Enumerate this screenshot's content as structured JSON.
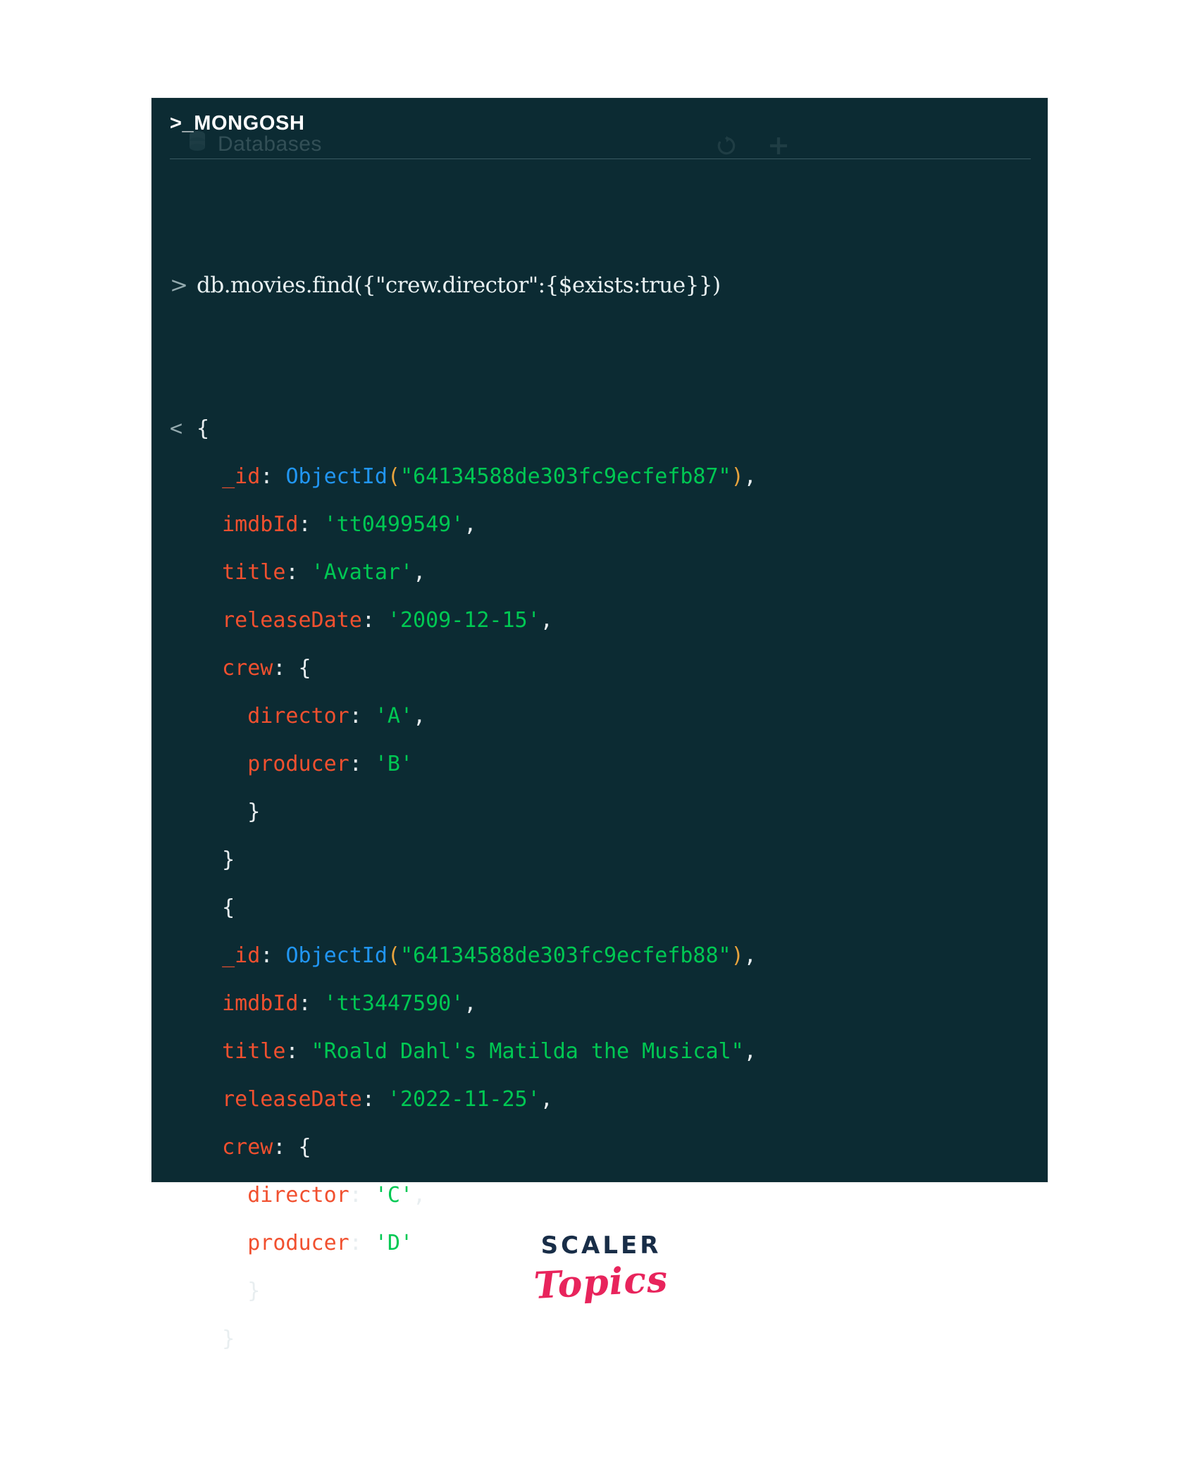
{
  "window": {
    "title": "MONGOSH",
    "prompt_glyph": ">_",
    "ghost": {
      "databases_label": "Databases",
      "database_icon": "database-icon",
      "refresh_icon": "refresh-icon",
      "add_icon": "plus-icon"
    },
    "background_color": "#0c2b33",
    "divider_color": "#3a5b63"
  },
  "command": {
    "gutter_glyph": ">",
    "text": "db.movies.find({\"crew.director\":{$exists:true}})"
  },
  "output": {
    "gutter_glyph": "<",
    "lines": [
      {
        "gutter": "<",
        "indent": 0,
        "tokens": [
          {
            "t": "{",
            "c": "brace"
          }
        ]
      },
      {
        "gutter": "",
        "indent": 1,
        "tokens": [
          {
            "t": "_id",
            "c": "key"
          },
          {
            "t": ": ",
            "c": "punct"
          },
          {
            "t": "ObjectId",
            "c": "func"
          },
          {
            "t": "(",
            "c": "paren"
          },
          {
            "t": "\"64134588de303fc9ecfefb87\"",
            "c": "string"
          },
          {
            "t": ")",
            "c": "paren"
          },
          {
            "t": ",",
            "c": "comma"
          }
        ]
      },
      {
        "gutter": "",
        "indent": 1,
        "tokens": [
          {
            "t": "imdbId",
            "c": "key"
          },
          {
            "t": ": ",
            "c": "punct"
          },
          {
            "t": "'tt0499549'",
            "c": "string"
          },
          {
            "t": ",",
            "c": "comma"
          }
        ]
      },
      {
        "gutter": "",
        "indent": 1,
        "tokens": [
          {
            "t": "title",
            "c": "key"
          },
          {
            "t": ": ",
            "c": "punct"
          },
          {
            "t": "'Avatar'",
            "c": "string"
          },
          {
            "t": ",",
            "c": "comma"
          }
        ]
      },
      {
        "gutter": "",
        "indent": 1,
        "tokens": [
          {
            "t": "releaseDate",
            "c": "key"
          },
          {
            "t": ": ",
            "c": "punct"
          },
          {
            "t": "'2009-12-15'",
            "c": "string"
          },
          {
            "t": ",",
            "c": "comma"
          }
        ]
      },
      {
        "gutter": "",
        "indent": 1,
        "tokens": [
          {
            "t": "crew",
            "c": "key"
          },
          {
            "t": ": ",
            "c": "punct"
          },
          {
            "t": "{",
            "c": "brace"
          }
        ]
      },
      {
        "gutter": "",
        "indent": 2,
        "tokens": [
          {
            "t": "director",
            "c": "key"
          },
          {
            "t": ": ",
            "c": "punct"
          },
          {
            "t": "'A'",
            "c": "string"
          },
          {
            "t": ",",
            "c": "comma"
          }
        ]
      },
      {
        "gutter": "",
        "indent": 2,
        "tokens": [
          {
            "t": "producer",
            "c": "key"
          },
          {
            "t": ": ",
            "c": "punct"
          },
          {
            "t": "'B'",
            "c": "string"
          }
        ]
      },
      {
        "gutter": "",
        "indent": 2,
        "tokens": [
          {
            "t": "}",
            "c": "brace"
          }
        ]
      },
      {
        "gutter": "",
        "indent": 1,
        "tokens": [
          {
            "t": "}",
            "c": "brace"
          }
        ]
      },
      {
        "gutter": "",
        "indent": 1,
        "tokens": [
          {
            "t": "{",
            "c": "brace"
          }
        ]
      },
      {
        "gutter": "",
        "indent": 1,
        "tokens": [
          {
            "t": "_id",
            "c": "key"
          },
          {
            "t": ": ",
            "c": "punct"
          },
          {
            "t": "ObjectId",
            "c": "func"
          },
          {
            "t": "(",
            "c": "paren"
          },
          {
            "t": "\"64134588de303fc9ecfefb88\"",
            "c": "string"
          },
          {
            "t": ")",
            "c": "paren"
          },
          {
            "t": ",",
            "c": "comma"
          }
        ]
      },
      {
        "gutter": "",
        "indent": 1,
        "tokens": [
          {
            "t": "imdbId",
            "c": "key"
          },
          {
            "t": ": ",
            "c": "punct"
          },
          {
            "t": "'tt3447590'",
            "c": "string"
          },
          {
            "t": ",",
            "c": "comma"
          }
        ]
      },
      {
        "gutter": "",
        "indent": 1,
        "tokens": [
          {
            "t": "title",
            "c": "key"
          },
          {
            "t": ": ",
            "c": "punct"
          },
          {
            "t": "\"Roald Dahl's Matilda the Musical\"",
            "c": "string"
          },
          {
            "t": ",",
            "c": "comma"
          }
        ]
      },
      {
        "gutter": "",
        "indent": 1,
        "tokens": [
          {
            "t": "releaseDate",
            "c": "key"
          },
          {
            "t": ": ",
            "c": "punct"
          },
          {
            "t": "'2022-11-25'",
            "c": "string"
          },
          {
            "t": ",",
            "c": "comma"
          }
        ]
      },
      {
        "gutter": "",
        "indent": 1,
        "tokens": [
          {
            "t": "crew",
            "c": "key"
          },
          {
            "t": ": ",
            "c": "punct"
          },
          {
            "t": "{",
            "c": "brace"
          }
        ]
      },
      {
        "gutter": "",
        "indent": 2,
        "tokens": [
          {
            "t": "director",
            "c": "key"
          },
          {
            "t": ": ",
            "c": "punct"
          },
          {
            "t": "'C'",
            "c": "string"
          },
          {
            "t": ",",
            "c": "comma"
          }
        ]
      },
      {
        "gutter": "",
        "indent": 2,
        "tokens": [
          {
            "t": "producer",
            "c": "key"
          },
          {
            "t": ": ",
            "c": "punct"
          },
          {
            "t": "'D'",
            "c": "string"
          }
        ]
      },
      {
        "gutter": "",
        "indent": 2,
        "tokens": [
          {
            "t": "}",
            "c": "brace"
          }
        ]
      },
      {
        "gutter": "",
        "indent": 1,
        "tokens": [
          {
            "t": "}",
            "c": "brace"
          }
        ]
      }
    ]
  },
  "branding": {
    "scaler": "SCALER",
    "topics": "Topics",
    "scaler_color": "#182d47",
    "topics_color": "#e8245c"
  },
  "colors": {
    "key": "#f1502f",
    "func": "#2196f3",
    "string": "#00c853",
    "paren": "#e8a33d",
    "punct": "#e8eef0",
    "terminal_bg": "#0c2b33"
  }
}
